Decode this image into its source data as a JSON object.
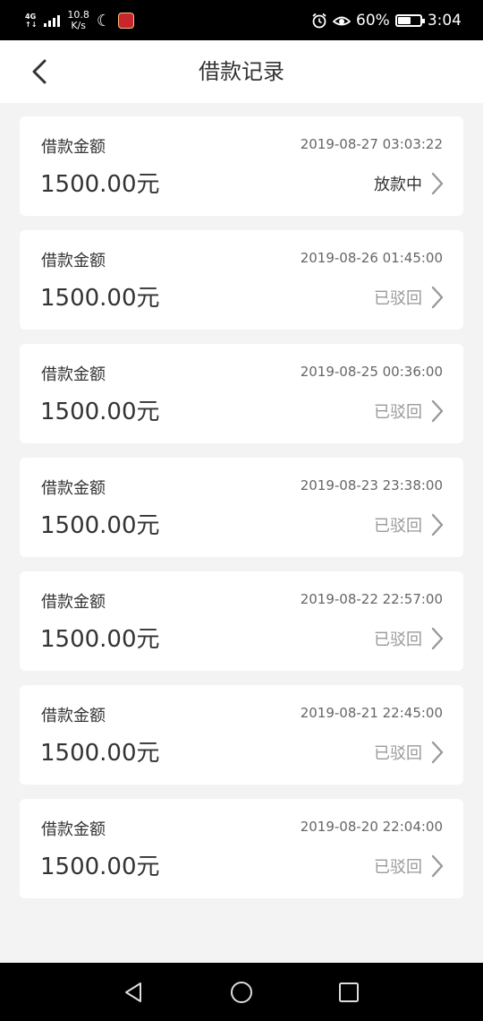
{
  "status_bar": {
    "network": "4G",
    "network_sub": "↑↓",
    "speed_value": "10.8",
    "speed_unit": "K/s",
    "battery": "60%",
    "battery_level": 0.6,
    "time": "3:04",
    "icons": [
      "signal-icon",
      "moon-icon",
      "app-notification-icon",
      "alarm-icon",
      "eye-comfort-icon",
      "battery-icon"
    ]
  },
  "header": {
    "title": "借款记录",
    "back_icon": "chevron-left-icon"
  },
  "records": [
    {
      "label": "借款金额",
      "date": "2019-08-27 03:03:22",
      "amount": "1500.00元",
      "status": "放款中",
      "active": true
    },
    {
      "label": "借款金额",
      "date": "2019-08-26 01:45:00",
      "amount": "1500.00元",
      "status": "已驳回",
      "active": false
    },
    {
      "label": "借款金额",
      "date": "2019-08-25 00:36:00",
      "amount": "1500.00元",
      "status": "已驳回",
      "active": false
    },
    {
      "label": "借款金额",
      "date": "2019-08-23 23:38:00",
      "amount": "1500.00元",
      "status": "已驳回",
      "active": false
    },
    {
      "label": "借款金额",
      "date": "2019-08-22 22:57:00",
      "amount": "1500.00元",
      "status": "已驳回",
      "active": false
    },
    {
      "label": "借款金额",
      "date": "2019-08-21 22:45:00",
      "amount": "1500.00元",
      "status": "已驳回",
      "active": false
    },
    {
      "label": "借款金额",
      "date": "2019-08-20 22:04:00",
      "amount": "1500.00元",
      "status": "已驳回",
      "active": false
    }
  ],
  "colors": {
    "page_background": "#f3f3f3",
    "card_background": "#ffffff",
    "text_primary": "#333333",
    "text_secondary": "#999999"
  }
}
